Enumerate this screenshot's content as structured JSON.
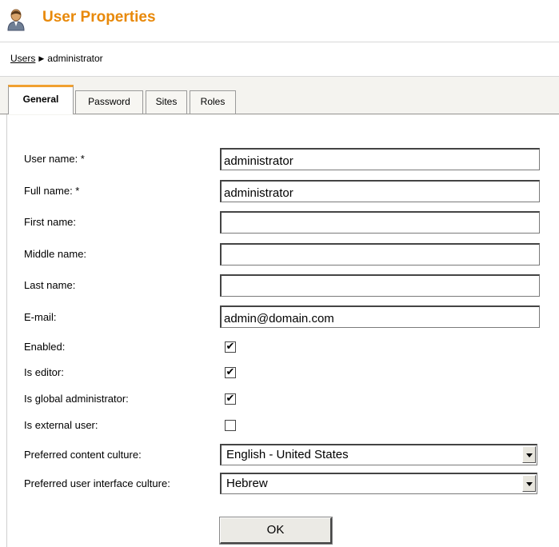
{
  "header": {
    "title": "User Properties",
    "icon": "user-icon"
  },
  "breadcrumb": {
    "parent": "Users",
    "current": "administrator"
  },
  "tabs": [
    {
      "label": "General",
      "active": true
    },
    {
      "label": "Password",
      "active": false
    },
    {
      "label": "Sites",
      "active": false
    },
    {
      "label": "Roles",
      "active": false
    }
  ],
  "form": {
    "username": {
      "label": "User name: *",
      "value": "administrator"
    },
    "fullname": {
      "label": "Full name: *",
      "value": "administrator"
    },
    "firstname": {
      "label": "First name:",
      "value": ""
    },
    "middlename": {
      "label": "Middle name:",
      "value": ""
    },
    "lastname": {
      "label": "Last name:",
      "value": ""
    },
    "email": {
      "label": "E-mail:",
      "value": "admin@domain.com"
    },
    "enabled": {
      "label": "Enabled:",
      "checked": true,
      "mark": "✔"
    },
    "is_editor": {
      "label": "Is editor:",
      "checked": true,
      "mark": "✔"
    },
    "is_global_admin": {
      "label": "Is global administrator:",
      "checked": true,
      "mark": "✔"
    },
    "is_external": {
      "label": "Is external user:",
      "checked": false,
      "mark": ""
    },
    "content_culture": {
      "label": "Preferred content culture:",
      "value": "English - United States"
    },
    "ui_culture": {
      "label": "Preferred user interface culture:",
      "value": "Hebrew"
    },
    "ok_label": "OK"
  },
  "colors": {
    "title": "#e8890a",
    "active_tab_accent": "#f0a030",
    "tab_strip": "#f4f3ef"
  }
}
